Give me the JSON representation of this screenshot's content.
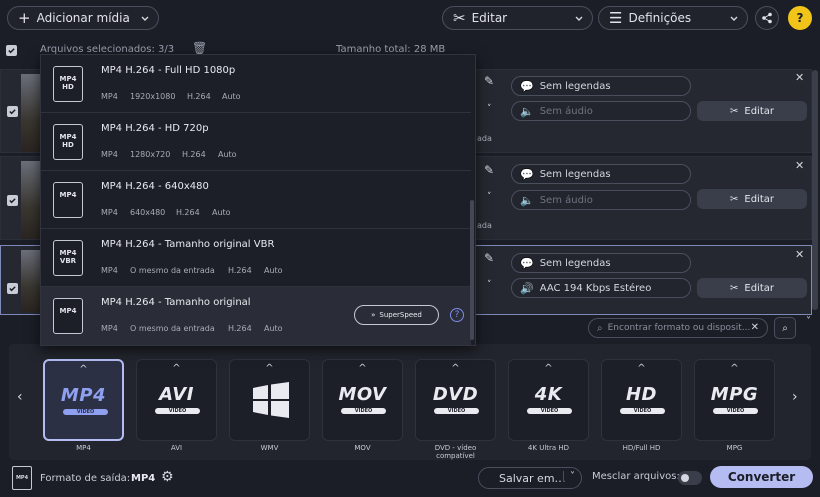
{
  "toolbar": {
    "add_media": "Adicionar mídia",
    "edit": "Editar",
    "settings": "Definições"
  },
  "selection": {
    "selected_files": "Arquivos selecionados: 3/3",
    "total_size": "Tamanho total: 28 MB"
  },
  "rows": [
    {
      "subtitles": "Sem legendas",
      "audio": "Sem áudio",
      "edit": "Editar",
      "side_text": "ada",
      "audio_dim": true
    },
    {
      "subtitles": "Sem legendas",
      "audio": "Sem áudio",
      "edit": "Editar",
      "side_text": "ada",
      "audio_dim": true
    },
    {
      "subtitles": "Sem legendas",
      "audio": "AAC 194 Kbps Estéreo",
      "edit": "Editar",
      "side_text": "",
      "audio_dim": false
    }
  ],
  "presets": [
    {
      "icon_line1": "MP4",
      "icon_line2": "HD",
      "title": "MP4 H.264 - Full HD 1080p",
      "container": "MP4",
      "resolution": "1920x1080",
      "codec": "H.264",
      "bitrate": "Auto"
    },
    {
      "icon_line1": "MP4",
      "icon_line2": "HD",
      "title": "MP4 H.264 - HD 720p",
      "container": "MP4",
      "resolution": "1280x720",
      "codec": "H.264",
      "bitrate": "Auto"
    },
    {
      "icon_line1": "MP4",
      "icon_line2": "",
      "title": "MP4 H.264 - 640x480",
      "container": "MP4",
      "resolution": "640x480",
      "codec": "H.264",
      "bitrate": "Auto"
    },
    {
      "icon_line1": "MP4",
      "icon_line2": "VBR",
      "title": "MP4 H.264 - Tamanho original VBR",
      "container": "MP4",
      "resolution": "O mesmo da entrada",
      "codec": "H.264",
      "bitrate": "Auto"
    },
    {
      "icon_line1": "MP4",
      "icon_line2": "",
      "title": "MP4 H.264 - Tamanho original",
      "container": "MP4",
      "resolution": "O mesmo da entrada",
      "codec": "H.264",
      "bitrate": "Auto"
    }
  ],
  "superspeed": "SuperSpeed",
  "search_placeholder": "Encontrar formato ou disposit...",
  "formats": [
    {
      "logo": "MP4",
      "sub": "VIDEO",
      "label": "MP4"
    },
    {
      "logo": "AVI",
      "sub": "VIDEO",
      "label": "AVI"
    },
    {
      "logo": "",
      "sub": "",
      "label": "WMV"
    },
    {
      "logo": "MOV",
      "sub": "VIDEO",
      "label": "MOV"
    },
    {
      "logo": "DVD",
      "sub": "VIDEO",
      "label": "DVD - vídeo compatível"
    },
    {
      "logo": "4K",
      "sub": "VIDEO",
      "label": "4K Ultra HD"
    },
    {
      "logo": "HD",
      "sub": "VIDEO",
      "label": "HD/Full HD"
    },
    {
      "logo": "MPG",
      "sub": "VIDEO",
      "label": "MPG"
    }
  ],
  "bottom": {
    "output_label": "Formato de saída:",
    "output_value": "MP4",
    "save_to": "Salvar em…",
    "merge": "Mesclar arquivos:",
    "convert": "Converter",
    "icon_text": "MP4"
  },
  "colors": {
    "accent": "#b4bcf2",
    "background": "#1b1e27"
  }
}
